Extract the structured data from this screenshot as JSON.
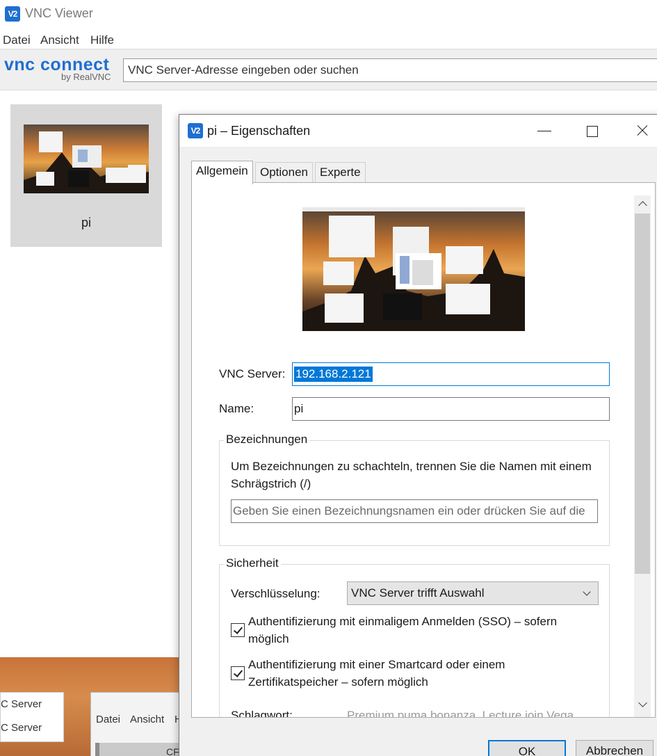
{
  "window": {
    "title": "VNC Viewer",
    "logo_text": "V2"
  },
  "menu": [
    "Datei",
    "Ansicht",
    "Hilfe"
  ],
  "brand": {
    "logo_main": "vnc connect",
    "logo_sub": "by RealVNC"
  },
  "search": {
    "placeholder": "VNC Server-Adresse eingeben oder suchen"
  },
  "computers": [
    {
      "name": "pi"
    }
  ],
  "background_app": {
    "list_items": [
      "C Server",
      "C Server"
    ],
    "menu": [
      "Datei",
      "Ansicht",
      "H"
    ],
    "bar_text": "CF"
  },
  "dialog": {
    "title": "pi – Eigenschaften",
    "tabs": [
      "Allgemein",
      "Optionen",
      "Experte"
    ],
    "active_tab": "Allgemein",
    "fields": {
      "server_label": "VNC Server:",
      "server_value": "192.168.2.121",
      "name_label": "Name:",
      "name_value": "pi"
    },
    "labels_group": {
      "title": "Bezeichnungen",
      "description": "Um Bezeichnungen zu schachteln, trennen Sie die Namen mit einem Schrägstrich (/)",
      "input_placeholder": "Geben Sie einen Bezeichnungsnamen ein oder drücken Sie auf die"
    },
    "security_group": {
      "title": "Sicherheit",
      "encryption_label": "Verschlüsselung:",
      "encryption_value": "VNC Server trifft Auswahl",
      "sso_label": "Authentifizierung mit einmaligem Anmelden (SSO) – sofern möglich",
      "sso_checked": true,
      "smartcard_label": "Authentifizierung mit einer Smartcard oder einem Zertifikatspeicher – sofern möglich",
      "smartcard_checked": true,
      "catchphrase_label": "Schlagwort:",
      "catchphrase_value": "Premium puma bonanza. Lecture join Vega"
    },
    "buttons": {
      "ok": "OK",
      "cancel": "Abbrechen"
    }
  },
  "colors": {
    "accent": "#0078d7",
    "brand_blue": "#1f6fd1",
    "tile_bg": "#d9d9d9"
  }
}
